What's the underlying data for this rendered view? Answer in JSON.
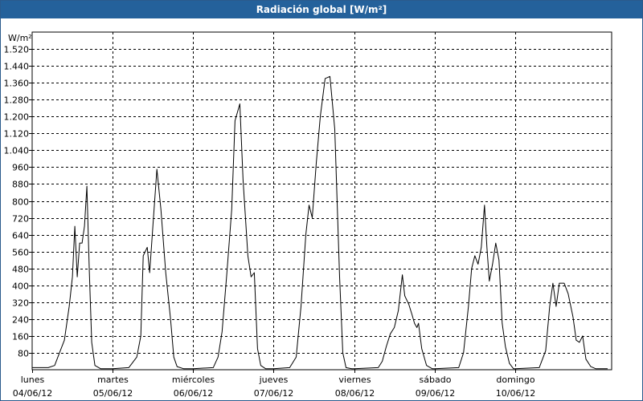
{
  "window": {
    "title": "Radiación global [W/m²]"
  },
  "chart_data": {
    "type": "line",
    "title": "Radiación global [W/m²]",
    "ylabel": "W/m²",
    "ylim": [
      0,
      1600
    ],
    "yticks": [
      "80",
      "160",
      "240",
      "320",
      "400",
      "480",
      "560",
      "640",
      "720",
      "800",
      "880",
      "960",
      "1.040",
      "1.120",
      "1.200",
      "1.280",
      "1.360",
      "1.440",
      "1.520"
    ],
    "ytick_values": [
      80,
      160,
      240,
      320,
      400,
      480,
      560,
      640,
      720,
      800,
      880,
      960,
      1040,
      1120,
      1200,
      1280,
      1360,
      1440,
      1520
    ],
    "xlim": [
      0,
      7.2
    ],
    "xticks": [
      {
        "day": "lunes",
        "date": "04/06/12",
        "x": 0
      },
      {
        "day": "martes",
        "date": "05/06/12",
        "x": 1
      },
      {
        "day": "miércoles",
        "date": "06/06/12",
        "x": 2
      },
      {
        "day": "jueves",
        "date": "07/06/12",
        "x": 3
      },
      {
        "day": "viernes",
        "date": "08/06/12",
        "x": 4
      },
      {
        "day": "sábado",
        "date": "09/06/12",
        "x": 5
      },
      {
        "day": "domingo",
        "date": "10/06/12",
        "x": 6
      }
    ],
    "grid": true,
    "series": [
      {
        "color": "#000000",
        "points": [
          [
            0.0,
            10
          ],
          [
            0.2,
            10
          ],
          [
            0.28,
            20
          ],
          [
            0.34,
            80
          ],
          [
            0.4,
            140
          ],
          [
            0.46,
            300
          ],
          [
            0.5,
            440
          ],
          [
            0.53,
            680
          ],
          [
            0.56,
            440
          ],
          [
            0.59,
            600
          ],
          [
            0.62,
            600
          ],
          [
            0.65,
            680
          ],
          [
            0.68,
            870
          ],
          [
            0.71,
            470
          ],
          [
            0.74,
            130
          ],
          [
            0.78,
            20
          ],
          [
            0.85,
            5
          ],
          [
            1.0,
            5
          ],
          [
            1.2,
            10
          ],
          [
            1.3,
            60
          ],
          [
            1.35,
            160
          ],
          [
            1.38,
            540
          ],
          [
            1.43,
            580
          ],
          [
            1.46,
            460
          ],
          [
            1.5,
            680
          ],
          [
            1.55,
            950
          ],
          [
            1.6,
            760
          ],
          [
            1.66,
            460
          ],
          [
            1.72,
            240
          ],
          [
            1.76,
            60
          ],
          [
            1.8,
            15
          ],
          [
            1.88,
            5
          ],
          [
            2.0,
            5
          ],
          [
            2.25,
            10
          ],
          [
            2.31,
            60
          ],
          [
            2.36,
            180
          ],
          [
            2.42,
            460
          ],
          [
            2.48,
            760
          ],
          [
            2.52,
            1180
          ],
          [
            2.58,
            1260
          ],
          [
            2.62,
            900
          ],
          [
            2.68,
            540
          ],
          [
            2.72,
            440
          ],
          [
            2.76,
            460
          ],
          [
            2.8,
            100
          ],
          [
            2.84,
            20
          ],
          [
            2.9,
            5
          ],
          [
            3.0,
            5
          ],
          [
            3.2,
            10
          ],
          [
            3.28,
            60
          ],
          [
            3.34,
            300
          ],
          [
            3.4,
            640
          ],
          [
            3.44,
            780
          ],
          [
            3.48,
            720
          ],
          [
            3.53,
            980
          ],
          [
            3.58,
            1200
          ],
          [
            3.64,
            1380
          ],
          [
            3.7,
            1390
          ],
          [
            3.76,
            1140
          ],
          [
            3.82,
            440
          ],
          [
            3.86,
            80
          ],
          [
            3.9,
            10
          ],
          [
            3.97,
            5
          ],
          [
            4.0,
            5
          ],
          [
            4.3,
            10
          ],
          [
            4.35,
            40
          ],
          [
            4.4,
            110
          ],
          [
            4.45,
            170
          ],
          [
            4.5,
            200
          ],
          [
            4.55,
            280
          ],
          [
            4.6,
            450
          ],
          [
            4.63,
            350
          ],
          [
            4.68,
            310
          ],
          [
            4.72,
            260
          ],
          [
            4.75,
            220
          ],
          [
            4.78,
            200
          ],
          [
            4.8,
            220
          ],
          [
            4.84,
            100
          ],
          [
            4.9,
            20
          ],
          [
            4.97,
            5
          ],
          [
            5.0,
            5
          ],
          [
            5.3,
            10
          ],
          [
            5.36,
            80
          ],
          [
            5.42,
            300
          ],
          [
            5.46,
            480
          ],
          [
            5.5,
            540
          ],
          [
            5.54,
            500
          ],
          [
            5.58,
            580
          ],
          [
            5.62,
            780
          ],
          [
            5.65,
            580
          ],
          [
            5.68,
            420
          ],
          [
            5.72,
            500
          ],
          [
            5.76,
            600
          ],
          [
            5.8,
            520
          ],
          [
            5.84,
            220
          ],
          [
            5.88,
            110
          ],
          [
            5.93,
            30
          ],
          [
            5.98,
            5
          ],
          [
            6.0,
            5
          ],
          [
            6.3,
            10
          ],
          [
            6.38,
            90
          ],
          [
            6.43,
            300
          ],
          [
            6.47,
            410
          ],
          [
            6.51,
            300
          ],
          [
            6.55,
            410
          ],
          [
            6.61,
            410
          ],
          [
            6.66,
            360
          ],
          [
            6.72,
            250
          ],
          [
            6.76,
            140
          ],
          [
            6.8,
            130
          ],
          [
            6.84,
            160
          ],
          [
            6.88,
            50
          ],
          [
            6.94,
            15
          ],
          [
            7.0,
            5
          ],
          [
            7.15,
            5
          ]
        ]
      }
    ]
  }
}
